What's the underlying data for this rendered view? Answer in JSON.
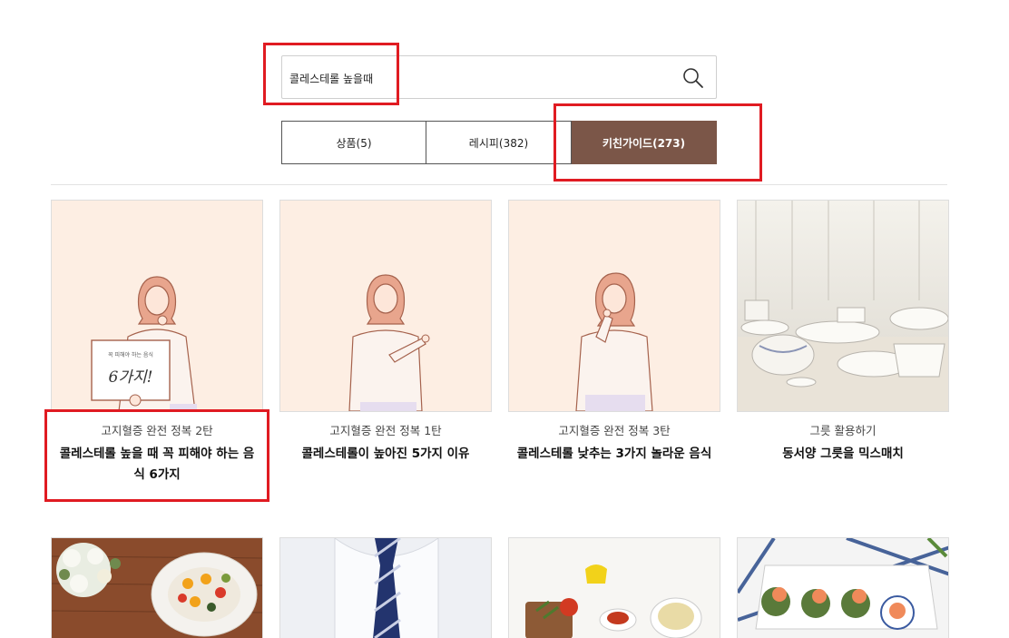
{
  "search": {
    "value": "콜레스테롤 높을때"
  },
  "tabs": [
    {
      "label": "상품(5)"
    },
    {
      "label": "레시피(382)"
    },
    {
      "label": "키친가이드(273)"
    }
  ],
  "cards": [
    {
      "category": "고지혈증 완전 정복 2탄",
      "title": "콜레스테롤 높을 때 꼭 피해야 하는 음식 6가지",
      "sign_small": "꼭 피해야 하는 음식",
      "sign_big": "6가지!"
    },
    {
      "category": "고지혈증 완전 정복 1탄",
      "title": "콜레스테롤이 높아진 5가지 이유"
    },
    {
      "category": "고지혈증 완전 정복 3탄",
      "title": "콜레스테롤 낮추는 3가지 놀라운 음식"
    },
    {
      "category": "그릇 활용하기",
      "title": "동서양 그릇을 믹스매치"
    }
  ],
  "colors": {
    "accent": "#7b5648",
    "highlight": "#e01b22",
    "illustration_bg": "#fdeee3"
  }
}
